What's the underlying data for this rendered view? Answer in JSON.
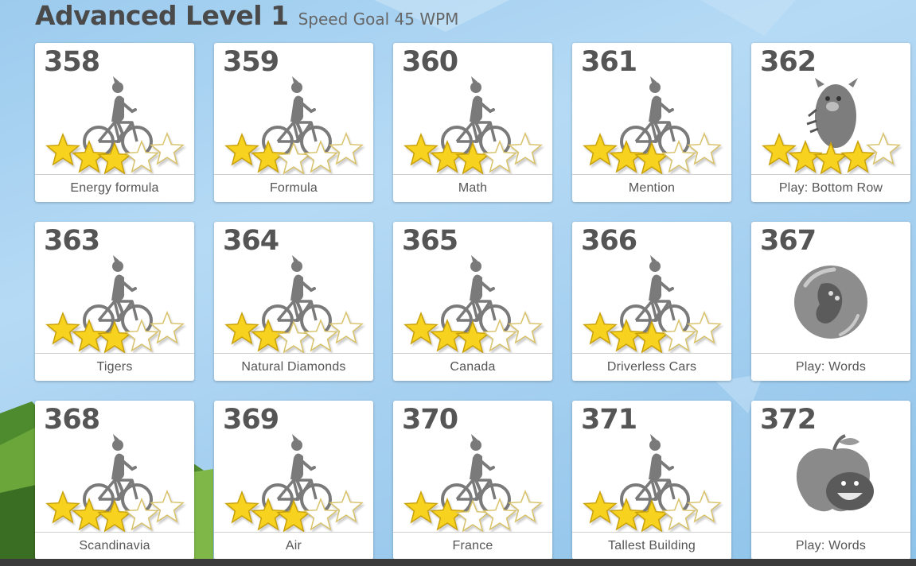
{
  "header": {
    "title": "Advanced Level 1",
    "subtitle": "Speed Goal 45 WPM"
  },
  "colors": {
    "star_fill": "#f7d320",
    "star_empty": "#ffffff",
    "icon_gray": "#7a7a7a"
  },
  "lessons": [
    {
      "number": "358",
      "label": "Energy formula",
      "icon": "cyclist-icon",
      "stars": 3
    },
    {
      "number": "359",
      "label": "Formula",
      "icon": "cyclist-icon",
      "stars": 2
    },
    {
      "number": "360",
      "label": "Math",
      "icon": "cyclist-icon",
      "stars": 3
    },
    {
      "number": "361",
      "label": "Mention",
      "icon": "cyclist-icon",
      "stars": 3
    },
    {
      "number": "362",
      "label": "Play: Bottom Row",
      "icon": "monster-icon",
      "stars": 4
    },
    {
      "number": "363",
      "label": "Tigers",
      "icon": "cyclist-icon",
      "stars": 3
    },
    {
      "number": "364",
      "label": "Natural Diamonds",
      "icon": "cyclist-icon",
      "stars": 2
    },
    {
      "number": "365",
      "label": "Canada",
      "icon": "cyclist-icon",
      "stars": 3
    },
    {
      "number": "366",
      "label": "Driverless Cars",
      "icon": "cyclist-icon",
      "stars": 3
    },
    {
      "number": "367",
      "label": "Play: Words",
      "icon": "bubble-creature-icon",
      "stars": 0
    },
    {
      "number": "368",
      "label": "Scandinavia",
      "icon": "cyclist-icon",
      "stars": 3
    },
    {
      "number": "369",
      "label": "Air",
      "icon": "cyclist-icon",
      "stars": 3
    },
    {
      "number": "370",
      "label": "France",
      "icon": "cyclist-icon",
      "stars": 2
    },
    {
      "number": "371",
      "label": "Tallest Building",
      "icon": "cyclist-icon",
      "stars": 3
    },
    {
      "number": "372",
      "label": "Play: Words",
      "icon": "apple-creature-icon",
      "stars": 0
    }
  ]
}
